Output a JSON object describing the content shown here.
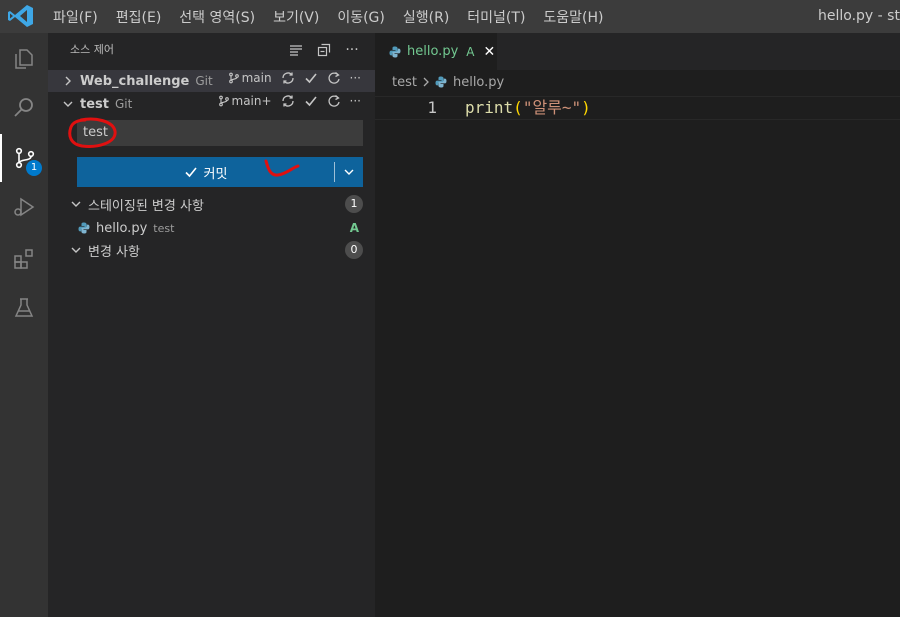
{
  "titlebar": {
    "menu": [
      "파일(F)",
      "편집(E)",
      "선택 영역(S)",
      "보기(V)",
      "이동(G)",
      "실행(R)",
      "터미널(T)",
      "도움말(H)"
    ],
    "window_title": "hello.py - sta"
  },
  "activitybar": {
    "icons": [
      "explorer-icon",
      "search-icon",
      "source-control-icon",
      "run-debug-icon",
      "extensions-icon",
      "testing-icon"
    ],
    "scm_badge": "1"
  },
  "sidebar": {
    "title": "소스 제어",
    "repos": [
      {
        "name": "Web_challenge",
        "provider": "Git",
        "branch": "main"
      },
      {
        "name": "test",
        "provider": "Git",
        "branch": "main+"
      }
    ],
    "commit_message": "test",
    "commit_label": "커밋",
    "staged": {
      "label": "스테이징된 변경 사항",
      "count": "1"
    },
    "staged_file": {
      "name": "hello.py",
      "dir": "test",
      "status": "A"
    },
    "changes": {
      "label": "변경 사항",
      "count": "0"
    }
  },
  "editor": {
    "tab": {
      "name": "hello.py",
      "status": "A"
    },
    "breadcrumb": {
      "folder": "test",
      "file": "hello.py"
    },
    "lines": [
      {
        "number": "1",
        "fn": "print",
        "open": "(",
        "str": "\"알루~\"",
        "close": ")"
      }
    ]
  },
  "colors": {
    "accent": "#007acc",
    "commit_button": "#0e639c",
    "annotation_red": "#e01010",
    "added_green": "#73c991"
  }
}
